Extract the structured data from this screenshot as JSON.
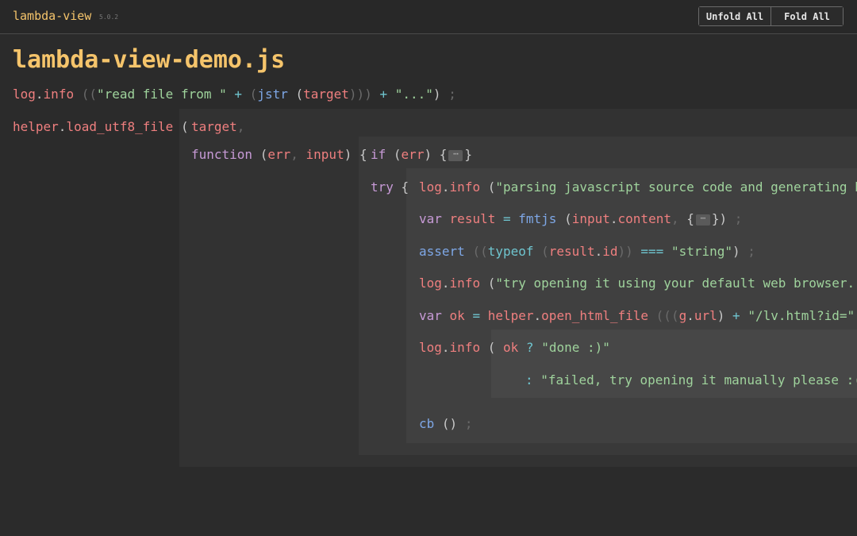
{
  "header": {
    "app_name": "lambda-view",
    "version": "5.0.2",
    "unfold_label": "Unfold All",
    "fold_label": "Fold All"
  },
  "file_title": "lambda-view-demo.js",
  "code": {
    "l1": {
      "log": "log",
      "info": "info",
      "open": "((",
      "s1": "\"read file from \"",
      "plus": "+",
      "p1": "(",
      "jstr": "jstr",
      "p2": "(",
      "target": "target",
      "close": ")))",
      "plus2": "+",
      "s2": "\"...\"",
      "end": ")",
      "semi": ";"
    },
    "l2": {
      "helper": "helper",
      "fn": "load_utf8_file",
      "open": "(",
      "target": "target",
      "comma": ","
    },
    "l3": {
      "function": "function",
      "open": "(",
      "err": "err",
      "comma": ",",
      "input": "input",
      "close": ")",
      "brace": "{",
      "if": "if",
      "popen": "(",
      "err2": "err",
      "pclose": ")",
      "bopen": "{",
      "fold": "⋯",
      "bclose": "}"
    },
    "l4": {
      "try": "try",
      "brace": "{",
      "log": "log",
      "info": "info",
      "open": "(",
      "str": "\"parsing javascript source code and generating html"
    },
    "l5": {
      "var": "var",
      "result": "result",
      "eq": "=",
      "fmtjs": "fmtjs",
      "open": "(",
      "input": "input",
      "content": "content",
      "comma": ",",
      "bopen": "{",
      "fold": "⋯",
      "bclose": "})",
      "semi": ";"
    },
    "l6": {
      "assert": "assert",
      "open": "((",
      "typeof": "typeof",
      "p2": "(",
      "result": "result",
      "id": "id",
      "close": "))",
      "op": "===",
      "str": "\"string\"",
      "end": ")",
      "semi": ";"
    },
    "l7": {
      "log": "log",
      "info": "info",
      "open": "(",
      "str": "\"try opening it using your default web browser...\"",
      "end": ")"
    },
    "l8": {
      "var": "var",
      "ok": "ok",
      "eq": "=",
      "helper": "helper",
      "fn": "open_html_file",
      "open": "(((",
      "g": "g",
      "url": "url",
      "close": ")",
      "plus": "+",
      "str": "\"/lv.html?id=\"",
      "end": ")",
      "plus2": "+"
    },
    "l9": {
      "log": "log",
      "info": "info",
      "open": "(",
      "ok": "ok",
      "q": "?",
      "str": "\"done :)\""
    },
    "l10": {
      "colon": ":",
      "str": "\"failed, try opening it manually please :(\""
    },
    "l11": {
      "cb": "cb",
      "paren": "()",
      "semi": ";"
    }
  }
}
